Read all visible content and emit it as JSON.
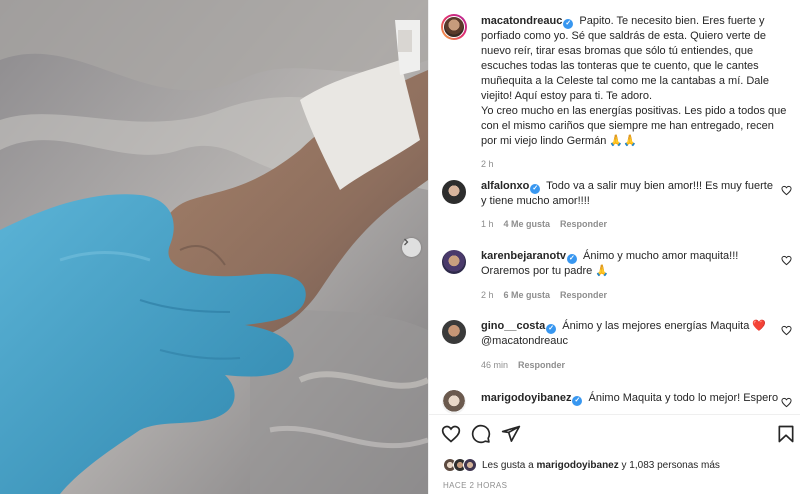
{
  "post": {
    "author": "macatondreauc",
    "caption_main": "Papito. Te necesito bien. Eres fuerte y porfiado como yo. Sé que saldrás de esta. Quiero verte de nuevo reír, tirar esas bromas que sólo tú entiendes, que escuches todas las tonteras que te cuento, que le cantes muñequita a la Celeste tal como me la cantabas a mí. Dale viejito! Aquí estoy para ti. Te adoro.",
    "caption_second": "Yo creo mucho en las energías positivas. Les pido a todos que con el mismo cariños que siempre me han entregado, recen por mi viejo lindo Germán 🙏🙏",
    "time": "2 h"
  },
  "comments": [
    {
      "username": "alfalonxo",
      "text": "Todo va a salir muy bien amor!!! Es muy fuerte y tiene mucho amor!!!!",
      "time": "1 h",
      "likes": "4 Me gusta",
      "reply": "Responder"
    },
    {
      "username": "karenbejaranotv",
      "text": "Ánimo y mucho amor maquita!!! Oraremos por tu padre 🙏",
      "time": "2 h",
      "likes": "6 Me gusta",
      "reply": "Responder"
    },
    {
      "username": "gino__costa",
      "text": "Ánimo y las mejores energías Maquita ❤️ @macatondreauc",
      "time": "46 min",
      "reply": "Responder"
    },
    {
      "username": "marigodoyibanez",
      "text": "Ánimo Maquita y todo lo mejor! Espero"
    }
  ],
  "likes": {
    "prefix": "Les gusta a",
    "user": "marigodoyibanez",
    "suffix": "y 1,083 personas más"
  },
  "posted_ago": "HACE 2 HORAS",
  "colors": {
    "verified": "#3897f0",
    "heart_emoji": "#e0245e",
    "glove": "#4aa3c8"
  },
  "icons": [
    "chevron-right-icon",
    "heart-icon",
    "comment-icon",
    "share-icon",
    "bookmark-icon",
    "verified-icon"
  ]
}
